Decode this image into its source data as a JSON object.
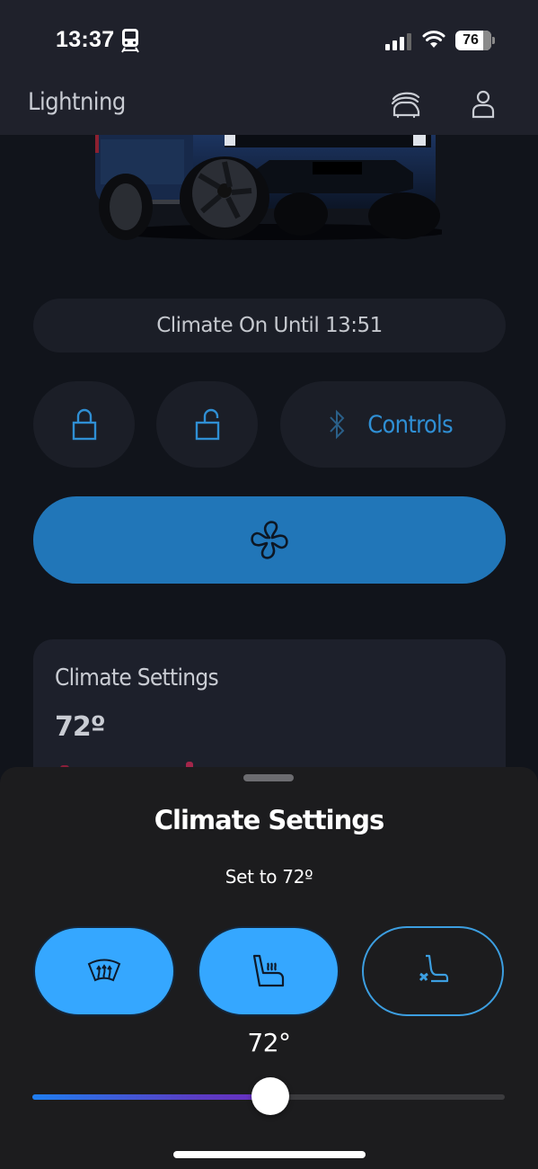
{
  "status_bar": {
    "time": "13:37",
    "focus_icon": "train-icon",
    "battery_level": "76",
    "signal_bars": 3,
    "signal_bars_total": 4
  },
  "header": {
    "title": "Lightning",
    "icons": [
      "garage-vehicles-icon",
      "profile-icon"
    ]
  },
  "vehicle": {
    "image_description": "Blue Ford F-150 Lightning truck, front view"
  },
  "climate_status": {
    "text": "Climate On Until 13:51"
  },
  "quick_actions": {
    "lock_icon": "lock-icon",
    "unlock_icon": "unlock-icon",
    "controls_label": "Controls",
    "controls_icon": "bluetooth-icon",
    "climate_icon": "fan-icon"
  },
  "settings_card": {
    "title": "Climate Settings",
    "temperature": "72º"
  },
  "sheet": {
    "title": "Climate Settings",
    "subtitle": "Set to 72º",
    "toggles": [
      {
        "name": "front-defrost",
        "icon": "windshield-defrost-icon",
        "active": true
      },
      {
        "name": "heated-seat",
        "icon": "heated-seat-icon",
        "active": true
      },
      {
        "name": "ventilated-seat",
        "icon": "ventilated-seat-icon",
        "active": false
      }
    ],
    "slider_value_label": "72°",
    "slider_fraction": 0.5
  },
  "colors": {
    "accent": "#35a7ff",
    "climate_button": "#2176b8",
    "controls_text": "#2f8fd4"
  }
}
